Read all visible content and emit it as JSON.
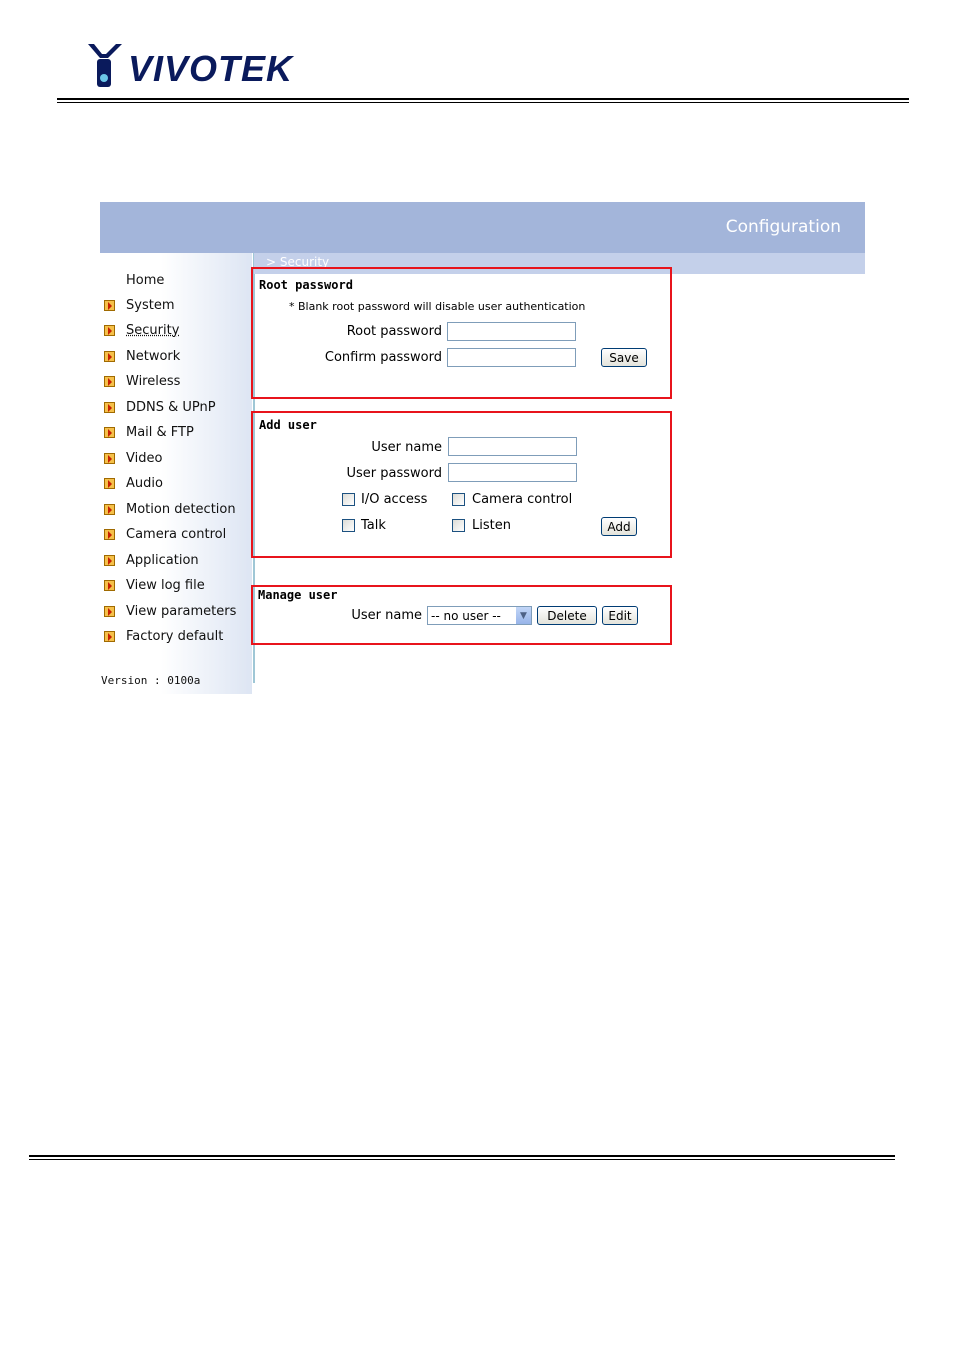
{
  "brand": {
    "name": "VIVOTEK"
  },
  "banner": {
    "title": "Configuration"
  },
  "breadcrumb": "> Security",
  "sidebar": {
    "items": [
      {
        "label": "Home",
        "has_bullet": false
      },
      {
        "label": "System",
        "has_bullet": true
      },
      {
        "label": "Security",
        "has_bullet": true,
        "active": true
      },
      {
        "label": "Network",
        "has_bullet": true
      },
      {
        "label": "Wireless",
        "has_bullet": true
      },
      {
        "label": "DDNS & UPnP",
        "has_bullet": true
      },
      {
        "label": "Mail & FTP",
        "has_bullet": true
      },
      {
        "label": "Video",
        "has_bullet": true
      },
      {
        "label": "Audio",
        "has_bullet": true
      },
      {
        "label": "Motion detection",
        "has_bullet": true
      },
      {
        "label": "Camera control",
        "has_bullet": true
      },
      {
        "label": "Application",
        "has_bullet": true
      },
      {
        "label": "View log file",
        "has_bullet": true
      },
      {
        "label": "View parameters",
        "has_bullet": true
      },
      {
        "label": "Factory default",
        "has_bullet": true
      }
    ],
    "version": "Version : 0100a"
  },
  "root_password": {
    "title": "Root password",
    "note": "* Blank root password will disable user authentication",
    "root_label": "Root password",
    "root_value": "",
    "confirm_label": "Confirm password",
    "confirm_value": "",
    "save_label": "Save"
  },
  "add_user": {
    "title": "Add user",
    "username_label": "User name",
    "username_value": "",
    "password_label": "User password",
    "password_value": "",
    "io_access_label": "I/O access",
    "camera_control_label": "Camera control",
    "talk_label": "Talk",
    "listen_label": "Listen",
    "add_label": "Add"
  },
  "manage_user": {
    "title": "Manage user",
    "username_label": "User name",
    "selected_user": "-- no user --",
    "delete_label": "Delete",
    "edit_label": "Edit"
  },
  "colors": {
    "banner": "#a3b5da",
    "highlight_border": "#e8141c",
    "brand": "#0a1a5c"
  }
}
